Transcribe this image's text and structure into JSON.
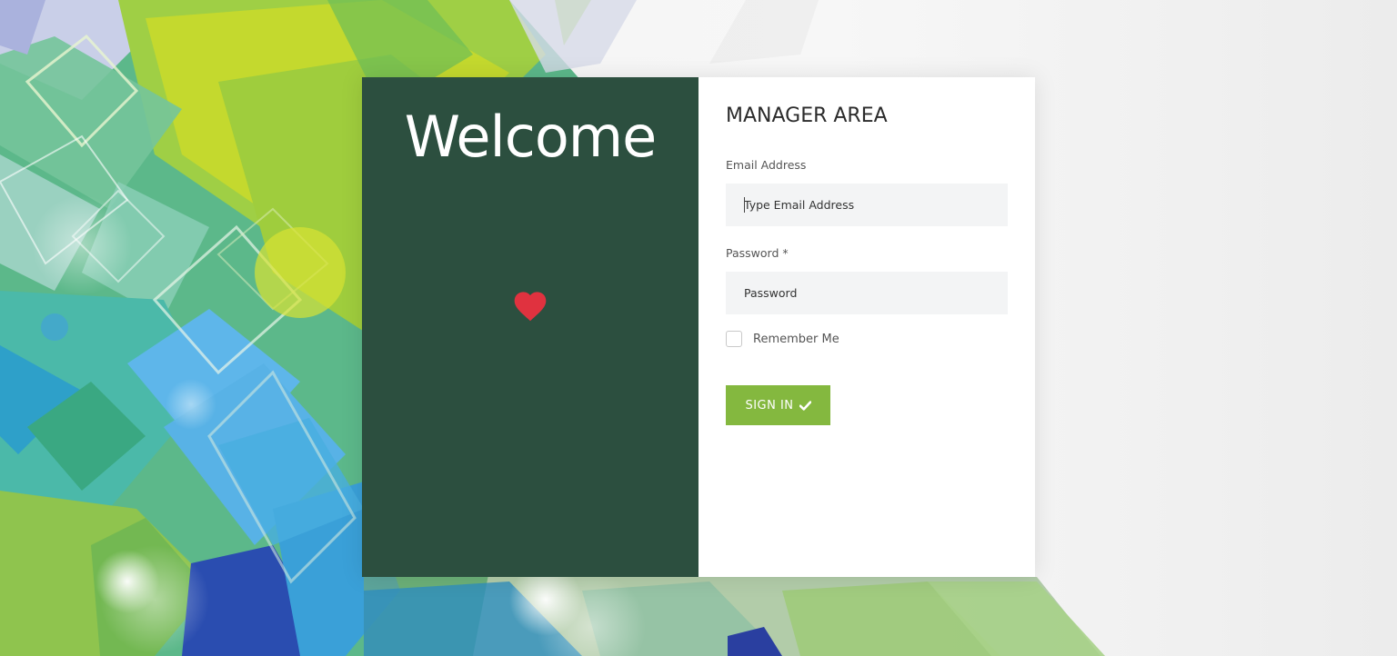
{
  "welcome": {
    "title": "Welcome",
    "icon": "heart-icon",
    "panel_color": "#2c4f3f",
    "heart_color": "#e0323f"
  },
  "form": {
    "title": "MANAGER AREA",
    "email": {
      "label": "Email Address",
      "placeholder": "Type Email Address",
      "value": ""
    },
    "password": {
      "label": "Password *",
      "placeholder": "Password",
      "value": ""
    },
    "remember": {
      "label": "Remember Me",
      "checked": false
    },
    "submit": {
      "label": "SIGN IN",
      "icon": "check-icon",
      "color": "#84b83f"
    }
  }
}
